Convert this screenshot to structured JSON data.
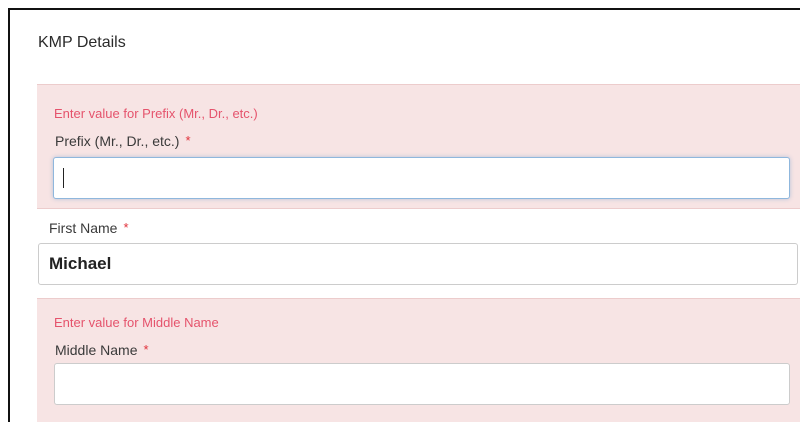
{
  "section": {
    "title": "KMP Details"
  },
  "required_marker": "*",
  "fields": {
    "prefix": {
      "error": "Enter value for Prefix (Mr., Dr., etc.)",
      "label": "Prefix (Mr., Dr., etc.)",
      "value": "",
      "focused": true
    },
    "first_name": {
      "label": "First Name",
      "value": "Michael"
    },
    "middle_name": {
      "error": "Enter value for Middle Name",
      "label": "Middle Name",
      "value": ""
    }
  },
  "colors": {
    "error_text": "#e5536c",
    "error_background": "#f7e4e4",
    "required_marker": "#e0303a",
    "focus_border": "#8fb7dd"
  }
}
